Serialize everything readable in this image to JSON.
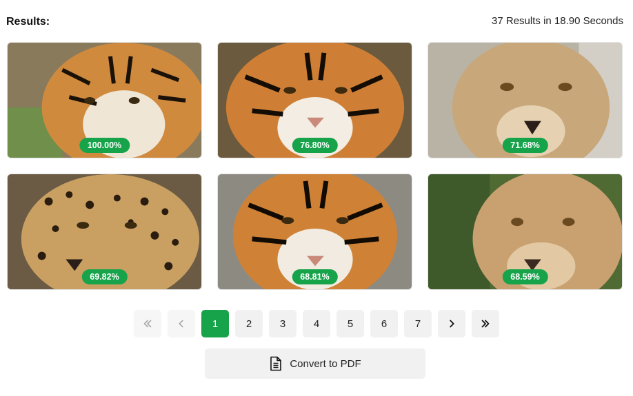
{
  "header": {
    "title": "Results:",
    "summary": "37 Results in 18.90 Seconds"
  },
  "results": [
    {
      "subject": "tiger",
      "score": "100.00%"
    },
    {
      "subject": "tiger",
      "score": "76.80%"
    },
    {
      "subject": "lioness",
      "score": "71.68%"
    },
    {
      "subject": "jaguar",
      "score": "69.82%"
    },
    {
      "subject": "tiger",
      "score": "68.81%"
    },
    {
      "subject": "lioness",
      "score": "68.59%"
    }
  ],
  "pagination": {
    "first_icon": "double-chevron-left-icon",
    "prev_icon": "chevron-left-icon",
    "pages": [
      "1",
      "2",
      "3",
      "4",
      "5",
      "6",
      "7"
    ],
    "current_page": "1",
    "next_icon": "chevron-right-icon",
    "last_icon": "double-chevron-right-icon"
  },
  "actions": {
    "convert_pdf_label": "Convert to PDF",
    "convert_pdf_icon": "document-icon"
  },
  "colors": {
    "accent": "#16a34a"
  }
}
